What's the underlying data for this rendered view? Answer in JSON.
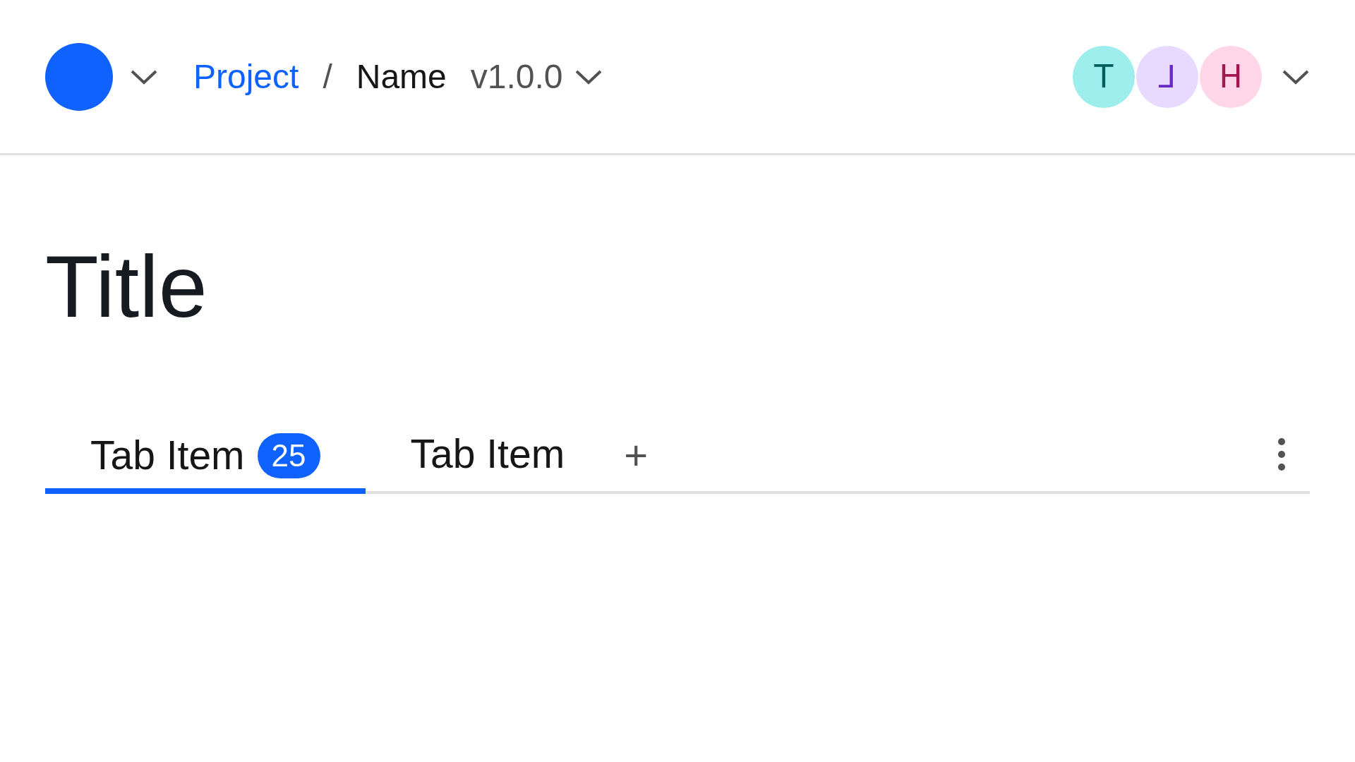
{
  "header": {
    "breadcrumb": [
      {
        "label": "Project",
        "kind": "link"
      },
      {
        "label": "/",
        "kind": "separator"
      },
      {
        "label": "Name",
        "kind": "current"
      }
    ],
    "version": "v1.0.0",
    "avatars": [
      {
        "initial": "T",
        "color": "#9eeeee"
      },
      {
        "initial": "⅃",
        "color": "#e8daff"
      },
      {
        "initial": "H",
        "color": "#ffd6e8"
      }
    ]
  },
  "title": "Title",
  "tabs": [
    {
      "label": "Tab Item",
      "badge": "25",
      "selected": true
    },
    {
      "label": "Tab Item",
      "selected": false
    }
  ],
  "add_tab": "+"
}
